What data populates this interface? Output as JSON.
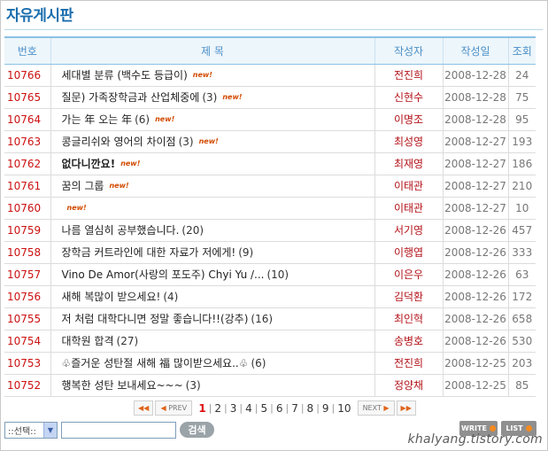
{
  "board": {
    "title": "자유게시판"
  },
  "columns": {
    "num": "번호",
    "subject": "제 목",
    "writer": "작성자",
    "date": "작성일",
    "hits": "조회"
  },
  "new_badge": "new!",
  "posts": [
    {
      "num": "10766",
      "subject": "세대별 분류 (백수도 등급이)",
      "comments": "",
      "is_new": true,
      "bold": false,
      "writer": "전진희",
      "date": "2008-12-28",
      "hits": "24"
    },
    {
      "num": "10765",
      "subject": "질문) 가족장학금과 산업체중에",
      "comments": "(3)",
      "is_new": true,
      "bold": false,
      "writer": "신현수",
      "date": "2008-12-28",
      "hits": "75"
    },
    {
      "num": "10764",
      "subject": "가는 年 오는 年",
      "comments": "(6)",
      "is_new": true,
      "bold": false,
      "writer": "이명조",
      "date": "2008-12-28",
      "hits": "95"
    },
    {
      "num": "10763",
      "subject": "콩글리쉬와 영어의 차이점",
      "comments": "(3)",
      "is_new": true,
      "bold": false,
      "writer": "최성영",
      "date": "2008-12-27",
      "hits": "193"
    },
    {
      "num": "10762",
      "subject": "없다니깐요!",
      "comments": "",
      "is_new": true,
      "bold": true,
      "writer": "최재영",
      "date": "2008-12-27",
      "hits": "186"
    },
    {
      "num": "10761",
      "subject": "꿈의 그룹",
      "comments": "",
      "is_new": true,
      "bold": false,
      "writer": "이태관",
      "date": "2008-12-27",
      "hits": "210"
    },
    {
      "num": "10760",
      "subject": "",
      "comments": "",
      "is_new": true,
      "bold": false,
      "writer": "이태관",
      "date": "2008-12-27",
      "hits": "10"
    },
    {
      "num": "10759",
      "subject": "나름 열심히 공부했습니다.",
      "comments": "(20)",
      "is_new": false,
      "bold": false,
      "writer": "서기영",
      "date": "2008-12-26",
      "hits": "457"
    },
    {
      "num": "10758",
      "subject": "장학금 커트라인에 대한 자료가 저에게!",
      "comments": "(9)",
      "is_new": false,
      "bold": false,
      "writer": "이행엽",
      "date": "2008-12-26",
      "hits": "333"
    },
    {
      "num": "10757",
      "subject": "Vino De Amor(사랑의 포도주) Chyi Yu /...",
      "comments": "(10)",
      "is_new": false,
      "bold": false,
      "writer": "이은우",
      "date": "2008-12-26",
      "hits": "63"
    },
    {
      "num": "10756",
      "subject": "새해 복많이 받으세요!",
      "comments": "(4)",
      "is_new": false,
      "bold": false,
      "writer": "김덕환",
      "date": "2008-12-26",
      "hits": "172"
    },
    {
      "num": "10755",
      "subject": "저 처럼 대학다니면 정말 좋습니다!!(강추)",
      "comments": "(16)",
      "is_new": false,
      "bold": false,
      "writer": "최인혁",
      "date": "2008-12-26",
      "hits": "658"
    },
    {
      "num": "10754",
      "subject": "대학원 합격",
      "comments": "(27)",
      "is_new": false,
      "bold": false,
      "writer": "송병호",
      "date": "2008-12-26",
      "hits": "530"
    },
    {
      "num": "10753",
      "subject": "♧즐거운 성탄절 새해 福 많이받으세요..♧",
      "comments": "(6)",
      "is_new": false,
      "bold": false,
      "writer": "전진희",
      "date": "2008-12-25",
      "hits": "203"
    },
    {
      "num": "10752",
      "subject": "행복한 성탄 보내세요~~~",
      "comments": "(3)",
      "is_new": false,
      "bold": false,
      "writer": "정양채",
      "date": "2008-12-25",
      "hits": "85"
    }
  ],
  "pagination": {
    "first_label": "◀◀",
    "prev_label": "PREV",
    "prev_arrow": "◀",
    "next_label": "NEXT",
    "next_arrow": "▶",
    "last_label": "▶▶",
    "pages": [
      "1",
      "2",
      "3",
      "4",
      "5",
      "6",
      "7",
      "8",
      "9",
      "10"
    ],
    "current": "1"
  },
  "search": {
    "select_value": "::선택::",
    "input_value": "",
    "button_label": "검색"
  },
  "actions": {
    "write_label": "WRITE",
    "list_label": "LIST"
  },
  "watermark": "khalyang.tistory.com",
  "colors": {
    "accent": "#1a6dad",
    "post_number": "#cc1111",
    "writer": "#b3131a",
    "new_badge": "#d24a00"
  }
}
